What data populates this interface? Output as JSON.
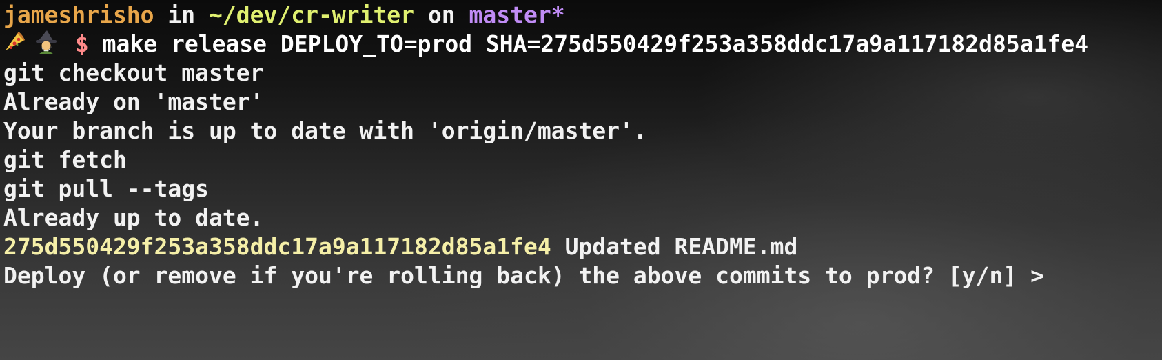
{
  "prompt": {
    "user": "jameshrisho",
    "in_word": " in ",
    "path": "~/dev/cr-writer",
    "on_word": " on ",
    "branch": "master*",
    "icons": [
      "pizza-icon",
      "mage-icon"
    ],
    "dollar": "$",
    "command": "make release DEPLOY_TO=prod SHA=275d550429f253a358ddc17a9a117182d85a1fe4"
  },
  "output": [
    "git checkout master",
    "Already on 'master'",
    "Your branch is up to date with 'origin/master'.",
    "git fetch",
    "git pull --tags",
    "Already up to date."
  ],
  "commit": {
    "sha": "275d550429f253a358ddc17a9a117182d85a1fe4",
    "message": " Updated README.md"
  },
  "question": "Deploy (or remove if you're rolling back) the above commits to prod? [y/n] >",
  "colors": {
    "user": "#e8a64a",
    "path": "#e0f070",
    "branch": "#c08cf5",
    "dollar": "#ff8a8a",
    "sha": "#f5efa8",
    "text": "#f2f2f2"
  }
}
